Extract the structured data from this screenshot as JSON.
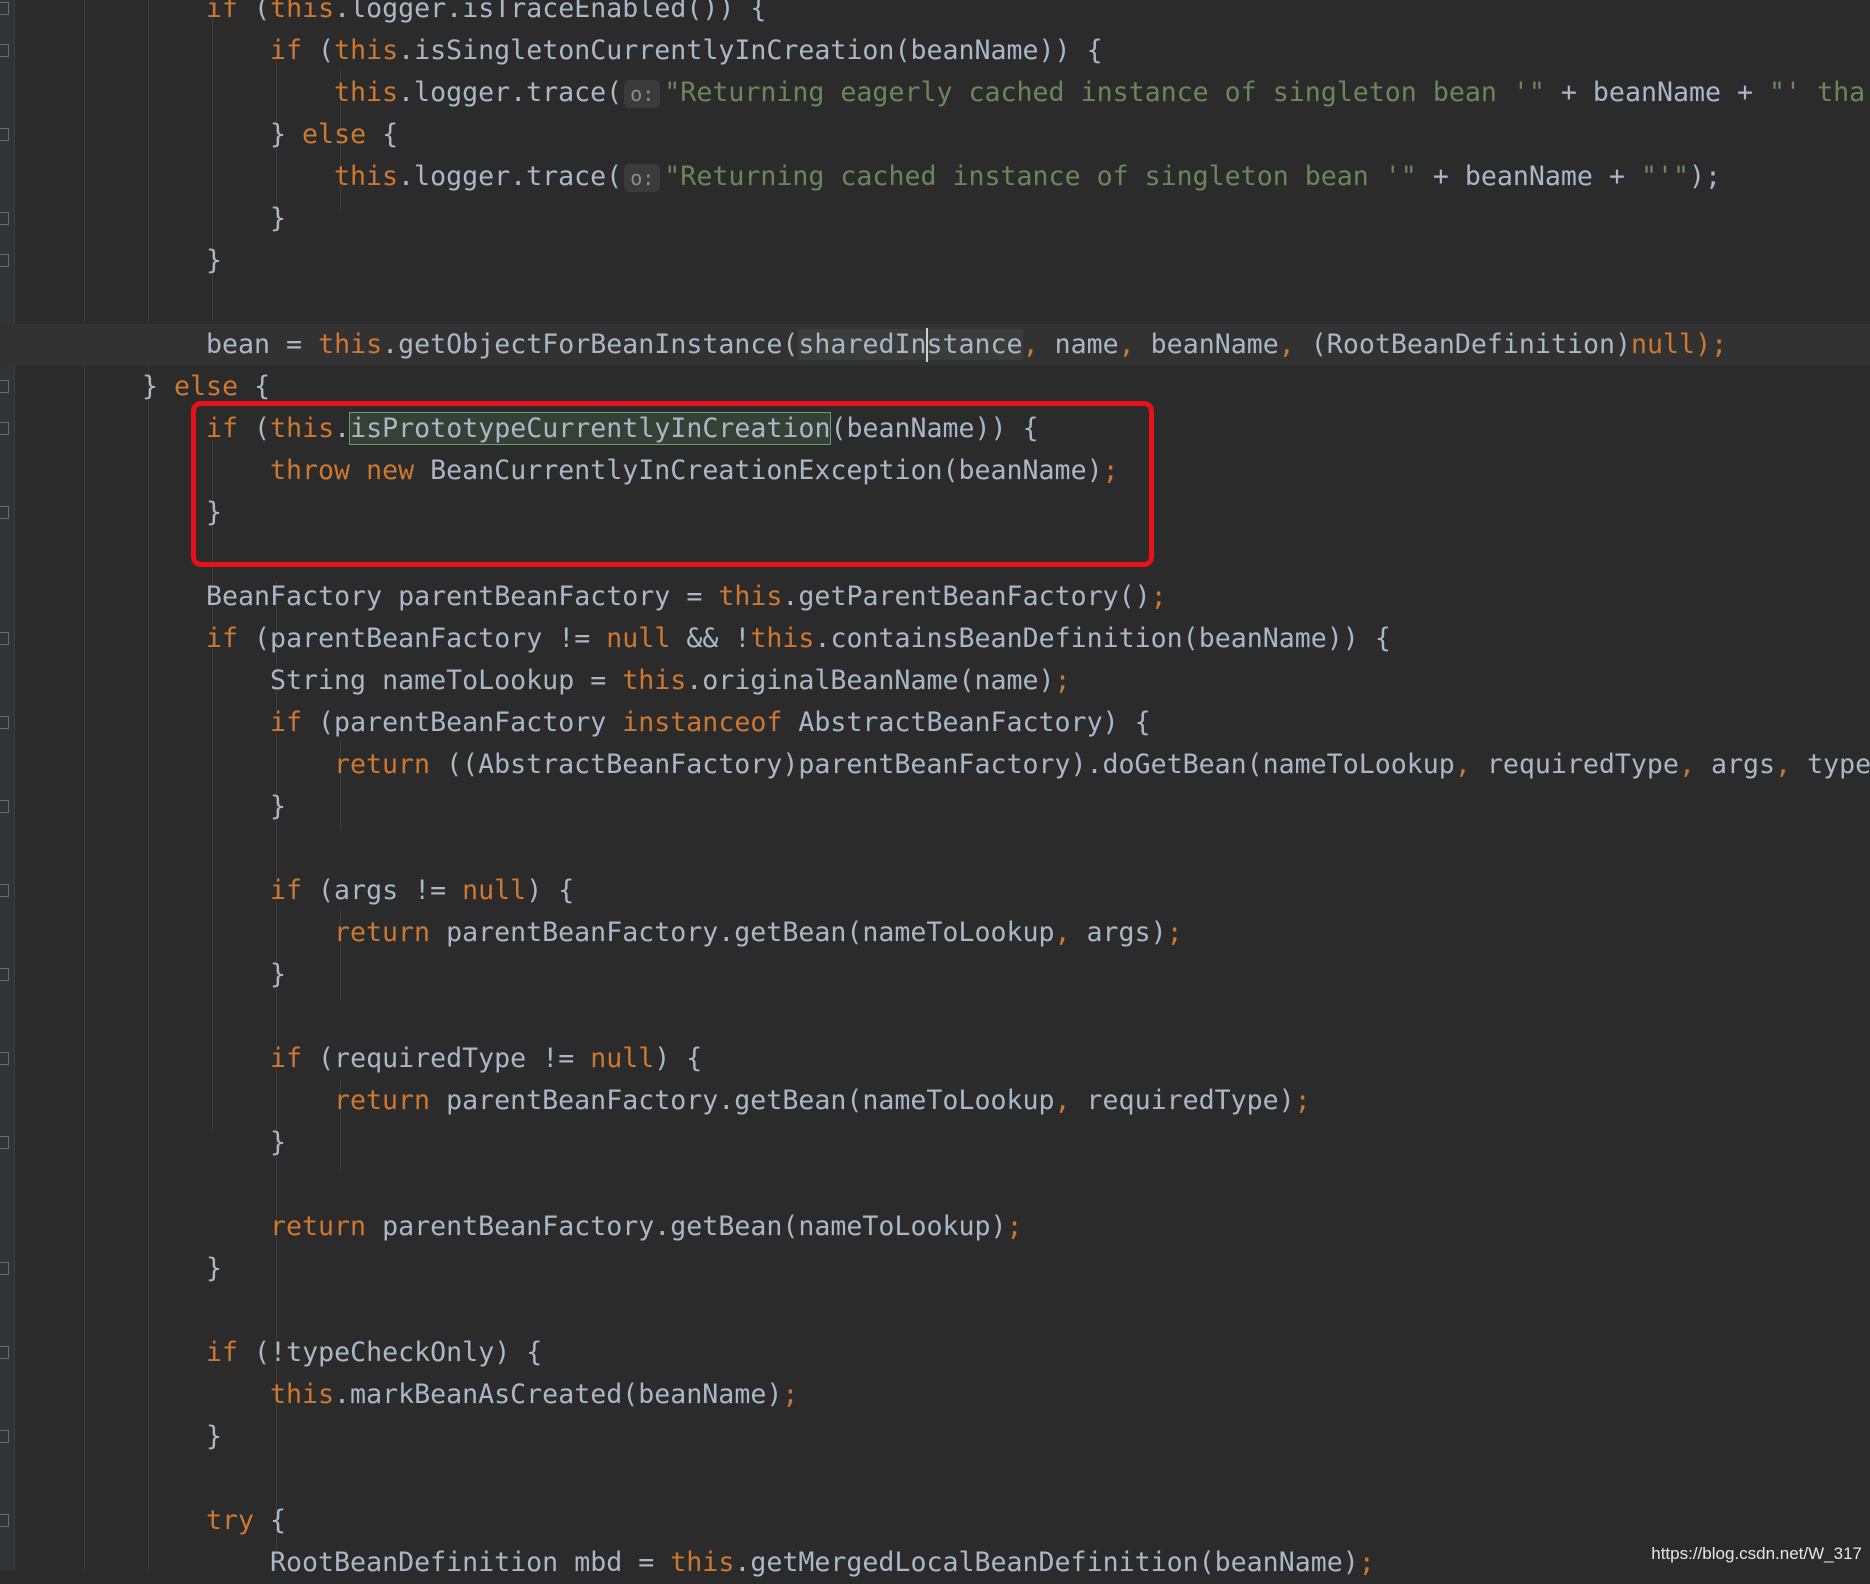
{
  "editor": {
    "language": "java",
    "colors": {
      "background": "#2b2b2b",
      "keyword": "#cc7832",
      "string": "#6a8759",
      "plain": "#a9b7c6",
      "highlight": "#344134",
      "annotation_box": "#e8101a"
    },
    "lines": [
      {
        "indent": 2,
        "tokens": [
          {
            "t": "if",
            "c": "k"
          },
          {
            "t": " (",
            "c": "p"
          },
          {
            "t": "this",
            "c": "k"
          },
          {
            "t": ".logger.isTraceEnabled()) {",
            "c": "p"
          }
        ]
      },
      {
        "indent": 3,
        "tokens": [
          {
            "t": "if",
            "c": "k"
          },
          {
            "t": " (",
            "c": "p"
          },
          {
            "t": "this",
            "c": "k"
          },
          {
            "t": ".isSingletonCurrentlyInCreation(beanName)) {",
            "c": "p"
          }
        ]
      },
      {
        "indent": 4,
        "tokens": [
          {
            "t": "this",
            "c": "k"
          },
          {
            "t": ".logger.trace(",
            "c": "p"
          },
          {
            "t": "o:",
            "c": "hint"
          },
          {
            "t": "\"Returning eagerly cached instance of singleton bean '\"",
            "c": "s"
          },
          {
            "t": " + beanName + ",
            "c": "p"
          },
          {
            "t": "\"' tha",
            "c": "s"
          }
        ]
      },
      {
        "indent": 3,
        "tokens": [
          {
            "t": "} ",
            "c": "p"
          },
          {
            "t": "else",
            "c": "k"
          },
          {
            "t": " {",
            "c": "p"
          }
        ]
      },
      {
        "indent": 4,
        "tokens": [
          {
            "t": "this",
            "c": "k"
          },
          {
            "t": ".logger.trace(",
            "c": "p"
          },
          {
            "t": "o:",
            "c": "hint"
          },
          {
            "t": "\"Returning cached instance of singleton bean '\"",
            "c": "s"
          },
          {
            "t": " + beanName + ",
            "c": "p"
          },
          {
            "t": "\"'\"",
            "c": "s"
          },
          {
            "t": ");",
            "c": "p"
          }
        ]
      },
      {
        "indent": 3,
        "tokens": [
          {
            "t": "}",
            "c": "p"
          }
        ]
      },
      {
        "indent": 2,
        "tokens": [
          {
            "t": "}",
            "c": "p"
          }
        ]
      },
      {
        "indent": 0,
        "tokens": []
      },
      {
        "indent": 2,
        "tokens": [
          {
            "t": "bean = ",
            "c": "p"
          },
          {
            "t": "this",
            "c": "k"
          },
          {
            "t": ".getObjectForBeanInstance(",
            "c": "p"
          },
          {
            "t": "sharedInstance",
            "c": "u"
          },
          {
            "t": ", ",
            "c": "k"
          },
          {
            "t": "name",
            "c": "p"
          },
          {
            "t": ", ",
            "c": "k"
          },
          {
            "t": "beanName",
            "c": "p"
          },
          {
            "t": ", ",
            "c": "k"
          },
          {
            "t": "(RootBeanDefinition)",
            "c": "p"
          },
          {
            "t": "null",
            "c": "k"
          },
          {
            "t": ");",
            "c": "k"
          }
        ]
      },
      {
        "indent": 1,
        "tokens": [
          {
            "t": "} ",
            "c": "p"
          },
          {
            "t": "else",
            "c": "k"
          },
          {
            "t": " {",
            "c": "p"
          }
        ]
      },
      {
        "indent": 2,
        "tokens": [
          {
            "t": "if",
            "c": "k"
          },
          {
            "t": " (",
            "c": "p"
          },
          {
            "t": "this",
            "c": "k"
          },
          {
            "t": ".",
            "c": "p"
          },
          {
            "t": "isPrototypeCurrentlyInCreation",
            "c": "h"
          },
          {
            "t": "(beanName)) {",
            "c": "p"
          }
        ]
      },
      {
        "indent": 3,
        "tokens": [
          {
            "t": "throw",
            "c": "k"
          },
          {
            "t": " ",
            "c": "p"
          },
          {
            "t": "new",
            "c": "k"
          },
          {
            "t": " BeanCurrentlyInCreationException(beanName)",
            "c": "p"
          },
          {
            "t": ";",
            "c": "k"
          }
        ]
      },
      {
        "indent": 2,
        "tokens": [
          {
            "t": "}",
            "c": "p"
          }
        ]
      },
      {
        "indent": 0,
        "tokens": []
      },
      {
        "indent": 2,
        "tokens": [
          {
            "t": "BeanFactory parentBeanFactory = ",
            "c": "p"
          },
          {
            "t": "this",
            "c": "k"
          },
          {
            "t": ".getParentBeanFactory()",
            "c": "p"
          },
          {
            "t": ";",
            "c": "k"
          }
        ]
      },
      {
        "indent": 2,
        "tokens": [
          {
            "t": "if",
            "c": "k"
          },
          {
            "t": " (parentBeanFactory != ",
            "c": "p"
          },
          {
            "t": "null",
            "c": "k"
          },
          {
            "t": " && !",
            "c": "p"
          },
          {
            "t": "this",
            "c": "k"
          },
          {
            "t": ".containsBeanDefinition(beanName)) {",
            "c": "p"
          }
        ]
      },
      {
        "indent": 3,
        "tokens": [
          {
            "t": "String nameToLookup = ",
            "c": "p"
          },
          {
            "t": "this",
            "c": "k"
          },
          {
            "t": ".originalBeanName(name)",
            "c": "p"
          },
          {
            "t": ";",
            "c": "k"
          }
        ]
      },
      {
        "indent": 3,
        "tokens": [
          {
            "t": "if",
            "c": "k"
          },
          {
            "t": " (parentBeanFactory ",
            "c": "p"
          },
          {
            "t": "instanceof",
            "c": "k"
          },
          {
            "t": " AbstractBeanFactory) {",
            "c": "p"
          }
        ]
      },
      {
        "indent": 4,
        "tokens": [
          {
            "t": "return",
            "c": "k"
          },
          {
            "t": " ((AbstractBeanFactory)parentBeanFactory).doGetBean(nameToLookup",
            "c": "p"
          },
          {
            "t": ", ",
            "c": "k"
          },
          {
            "t": "requiredType",
            "c": "p"
          },
          {
            "t": ", ",
            "c": "k"
          },
          {
            "t": "args",
            "c": "p"
          },
          {
            "t": ", ",
            "c": "k"
          },
          {
            "t": "type",
            "c": "p"
          }
        ]
      },
      {
        "indent": 3,
        "tokens": [
          {
            "t": "}",
            "c": "p"
          }
        ]
      },
      {
        "indent": 0,
        "tokens": []
      },
      {
        "indent": 3,
        "tokens": [
          {
            "t": "if",
            "c": "k"
          },
          {
            "t": " (args != ",
            "c": "p"
          },
          {
            "t": "null",
            "c": "k"
          },
          {
            "t": ") {",
            "c": "p"
          }
        ]
      },
      {
        "indent": 4,
        "tokens": [
          {
            "t": "return",
            "c": "k"
          },
          {
            "t": " parentBeanFactory.getBean(nameToLookup",
            "c": "p"
          },
          {
            "t": ", ",
            "c": "k"
          },
          {
            "t": "args)",
            "c": "p"
          },
          {
            "t": ";",
            "c": "k"
          }
        ]
      },
      {
        "indent": 3,
        "tokens": [
          {
            "t": "}",
            "c": "p"
          }
        ]
      },
      {
        "indent": 0,
        "tokens": []
      },
      {
        "indent": 3,
        "tokens": [
          {
            "t": "if",
            "c": "k"
          },
          {
            "t": " (requiredType != ",
            "c": "p"
          },
          {
            "t": "null",
            "c": "k"
          },
          {
            "t": ") {",
            "c": "p"
          }
        ]
      },
      {
        "indent": 4,
        "tokens": [
          {
            "t": "return",
            "c": "k"
          },
          {
            "t": " parentBeanFactory.getBean(nameToLookup",
            "c": "p"
          },
          {
            "t": ", ",
            "c": "k"
          },
          {
            "t": "requiredType)",
            "c": "p"
          },
          {
            "t": ";",
            "c": "k"
          }
        ]
      },
      {
        "indent": 3,
        "tokens": [
          {
            "t": "}",
            "c": "p"
          }
        ]
      },
      {
        "indent": 0,
        "tokens": []
      },
      {
        "indent": 3,
        "tokens": [
          {
            "t": "return",
            "c": "k"
          },
          {
            "t": " parentBeanFactory.getBean(nameToLookup)",
            "c": "p"
          },
          {
            "t": ";",
            "c": "k"
          }
        ]
      },
      {
        "indent": 2,
        "tokens": [
          {
            "t": "}",
            "c": "p"
          }
        ]
      },
      {
        "indent": 0,
        "tokens": []
      },
      {
        "indent": 2,
        "tokens": [
          {
            "t": "if",
            "c": "k"
          },
          {
            "t": " (!typeCheckOnly) {",
            "c": "p"
          }
        ]
      },
      {
        "indent": 3,
        "tokens": [
          {
            "t": "this",
            "c": "k"
          },
          {
            "t": ".markBeanAsCreated(beanName)",
            "c": "p"
          },
          {
            "t": ";",
            "c": "k"
          }
        ]
      },
      {
        "indent": 2,
        "tokens": [
          {
            "t": "}",
            "c": "p"
          }
        ]
      },
      {
        "indent": 0,
        "tokens": []
      },
      {
        "indent": 2,
        "tokens": [
          {
            "t": "try",
            "c": "k"
          },
          {
            "t": " {",
            "c": "p"
          }
        ]
      },
      {
        "indent": 3,
        "tokens": [
          {
            "t": "RootBeanDefinition mbd = ",
            "c": "p"
          },
          {
            "t": "this",
            "c": "k"
          },
          {
            "t": ".getMergedLocalBeanDefinition(beanName)",
            "c": "p"
          },
          {
            "t": ";",
            "c": "k"
          }
        ]
      }
    ]
  },
  "watermark": "https://blog.csdn.net/W_317"
}
